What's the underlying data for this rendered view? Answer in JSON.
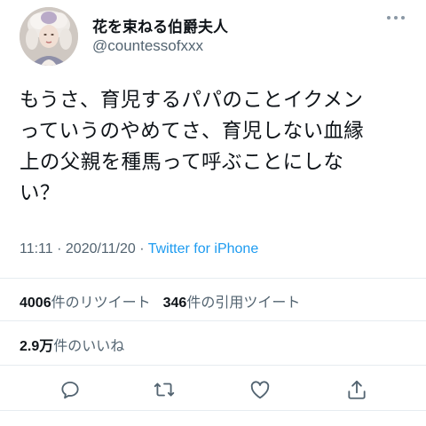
{
  "user": {
    "display_name": "花を束ねる伯爵夫人",
    "handle": "@countessofxxx"
  },
  "tweet": {
    "lines": [
      "もうさ、育児するパパのことイクメン",
      "っていうのやめてさ、育児しない血縁",
      "上の父親を種馬って呼ぶことにしな",
      "い？"
    ],
    "time": "11:11",
    "separator1": " · ",
    "date": "2020/11/20",
    "separator2": " · ",
    "source": "Twitter for iPhone"
  },
  "stats": {
    "retweets_count": "4006",
    "retweets_label": "件のリツイート",
    "quotes_count": "346",
    "quotes_label": "件の引用ツイート",
    "likes_count": "2.9万",
    "likes_label": "件のいいね"
  },
  "icons": {
    "more": "more-horizontal-icon",
    "reply": "reply-icon",
    "retweet": "retweet-icon",
    "like": "heart-icon",
    "share": "share-icon"
  },
  "colors": {
    "link": "#1d9bf0",
    "secondary_text": "#536471",
    "icon": "#536471"
  }
}
